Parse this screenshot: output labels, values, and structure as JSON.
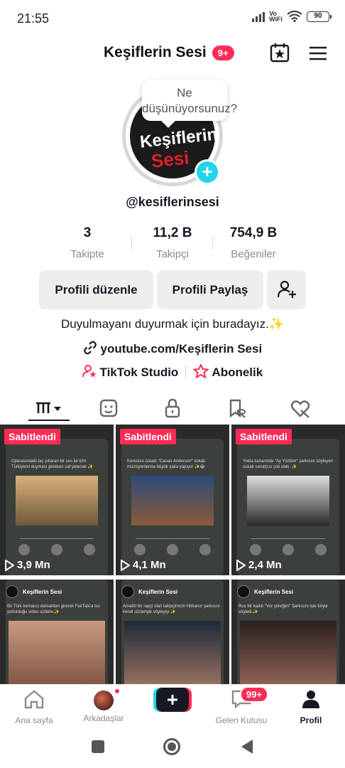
{
  "status": {
    "time": "21:55",
    "network": "Vo\nWiFi",
    "battery": "90"
  },
  "header": {
    "title": "Keşiflerin Sesi",
    "badge": "9+"
  },
  "profile": {
    "bubble_text": "Ne düşünüyorsunuz?",
    "avatar_line1": "Keşiflerin",
    "avatar_line2": "Sesi",
    "username": "@kesiflerinsesi",
    "stats": [
      {
        "value": "3",
        "label": "Takipte"
      },
      {
        "value": "11,2 B",
        "label": "Takipçi"
      },
      {
        "value": "754,9 B",
        "label": "Beğeniler"
      }
    ],
    "edit_label": "Profili düzenle",
    "share_label": "Profili Paylaş",
    "bio": "Duyulmayanı duyurmak için buradayız.✨",
    "link": "youtube.com/Keşiflerin Sesi",
    "studio_label": "TikTok Studio",
    "subscription_label": "Abonelik"
  },
  "videos": [
    {
      "pinned": "Sabitlendi",
      "views": "3,9 Mn",
      "caption": "Operasındaki taç çıkaran bir ses ile tüm Türkiyemi duyması gereken saf yetenek ✨",
      "photo_color": "#c8a15a"
    },
    {
      "pinned": "Sabitlendi",
      "views": "4,1 Mn",
      "caption": "Kemanın üstadı \"Canan Anderson\" sokak müzisyenlerine büyük şaka yapıyor ✨😂",
      "photo_color": "#7a5a3a"
    },
    {
      "pinned": "Sabitlendi",
      "views": "2,4 Mn",
      "caption": "Yolda kenarında \"Ay Yüzlüm\" şarkısını söyleyen sokak sanatçısı çok oldu. ✨",
      "photo_color": "#444444"
    },
    {
      "account": "Keşiflerin Sesi",
      "caption": "Bir Türk kemancı damardan girerek FairTale'a toz yutturduğu video sizlerle.✨",
      "photo_color": "#9b6a54"
    },
    {
      "account": "Keşiflerin Sesi",
      "caption": "Amatör bir rapçi olan takipçimizin Hidranın şarkısını kendi sözleriyle söyleyişi.✨",
      "photo_color": "#3a4a5a"
    },
    {
      "account": "Keşiflerin Sesi",
      "caption": "Rus bir kadın \"Vur yüreğim\" Şarkısını işte böyle söyledi.✨",
      "photo_color": "#8a5a50"
    }
  ],
  "bottom_nav": {
    "home": "Ana sayfa",
    "friends": "Arkadaşlar",
    "inbox": "Gelen Kutusu",
    "inbox_badge": "99+",
    "profile": "Profil"
  },
  "icons": [
    "calendar-star-icon",
    "menu-icon",
    "link-icon",
    "studio-icon",
    "subscription-icon",
    "grid-icon",
    "repost-icon",
    "lock-icon",
    "saved-icon",
    "liked-icon",
    "play-icon",
    "home-icon",
    "plus-icon",
    "inbox-icon",
    "profile-icon"
  ],
  "colors": {
    "accent": "#fe2c55",
    "cyan": "#20d5ec"
  }
}
